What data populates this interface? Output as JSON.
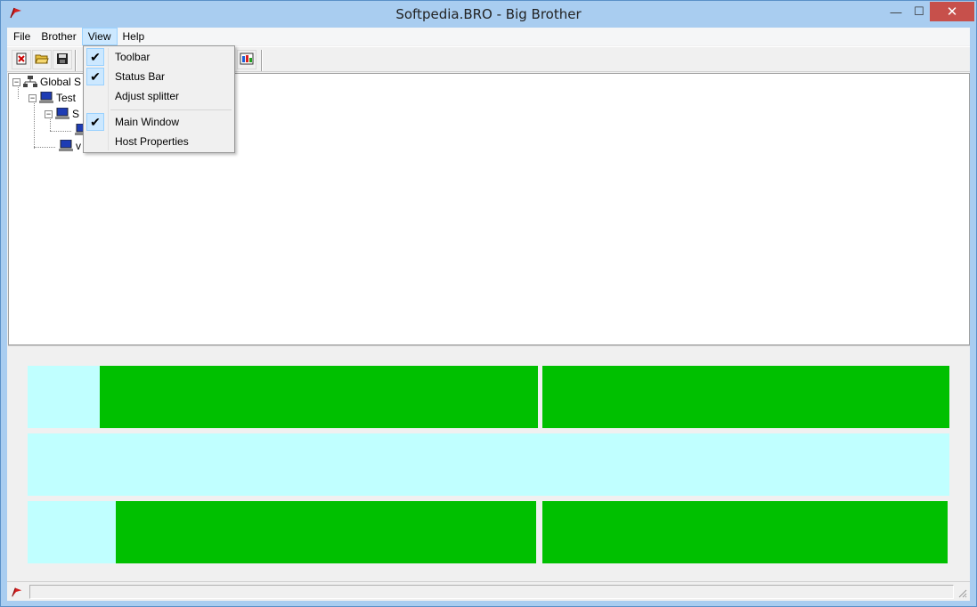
{
  "window": {
    "title": "Softpedia.BRO - Big Brother",
    "min_symbol": "—",
    "max_symbol": "☐",
    "close_symbol": "✕"
  },
  "menubar": {
    "items": [
      {
        "label": "File"
      },
      {
        "label": "Brother"
      },
      {
        "label": "View"
      },
      {
        "label": "Help"
      }
    ],
    "active": "View"
  },
  "view_menu": {
    "items": [
      {
        "label": "Toolbar",
        "checked": true
      },
      {
        "label": "Status Bar",
        "checked": true
      },
      {
        "label": "Adjust splitter",
        "checked": false
      },
      {
        "label": "Main Window",
        "checked": true
      },
      {
        "label": "Host Properties",
        "checked": false
      }
    ],
    "check_glyph": "✔"
  },
  "tree": {
    "nodes": [
      {
        "label": "Global S",
        "expander": "−"
      },
      {
        "label": "Test",
        "expander": "−"
      },
      {
        "label": "S",
        "expander": "−"
      },
      {
        "label": "",
        "expander": ""
      },
      {
        "label": "v",
        "expander": ""
      }
    ]
  },
  "status_grid": {
    "colors": {
      "ok": "#00c000",
      "empty": "#c0ffff"
    }
  },
  "icons": {
    "app": "red-flag-icon",
    "toolbar": [
      "new-icon",
      "open-folder-icon",
      "save-disk-icon",
      "properties-icon"
    ]
  }
}
